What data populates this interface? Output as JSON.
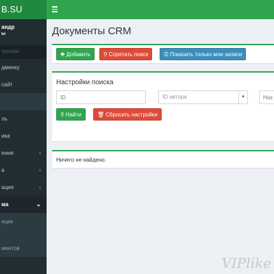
{
  "sidebar": {
    "logo": "B.SU",
    "user_name": "андр",
    "user_role": "ы",
    "header": "тратора",
    "items": [
      {
        "label": "дминку",
        "chevron": ""
      },
      {
        "label": "сайт",
        "chevron": ""
      },
      {
        "label": "",
        "chevron": ""
      },
      {
        "label": "ль",
        "chevron": ""
      },
      {
        "label": "ика",
        "chevron": ""
      },
      {
        "label": "ения",
        "chevron": "‹"
      },
      {
        "label": "а",
        "chevron": "‹"
      },
      {
        "label": "ация",
        "chevron": "‹"
      },
      {
        "label": "ма",
        "chevron": "⌄"
      },
      {
        "label": "ицик",
        "chevron": ""
      },
      {
        "label": "ментов",
        "chevron": ""
      }
    ]
  },
  "page": {
    "title": "Документы CRM"
  },
  "toolbar": {
    "add_label": "Добавить",
    "hide_search_label": "Спрятать поиск",
    "show_mine_label": "Показать только мои записи"
  },
  "search": {
    "title": "Настройки поиска",
    "id_placeholder": "ID",
    "author_placeholder": "ID автора",
    "name_placeholder": "Наз",
    "find_label": "Найти",
    "reset_label": "Сбросить настройки"
  },
  "results": {
    "empty_text": "Ничего не найдено."
  },
  "watermark": "VIPlike",
  "colors": {
    "topbar": "#2fa64e",
    "sidebar": "#222d32",
    "btn_green": "#2fa64e",
    "btn_red": "#dd4b39",
    "btn_blue": "#3c8dbc"
  },
  "icons": {
    "menu": "hamburger-icon",
    "add": "plus-icon",
    "search": "search-icon",
    "list": "list-icon",
    "trash": "trash-icon"
  }
}
